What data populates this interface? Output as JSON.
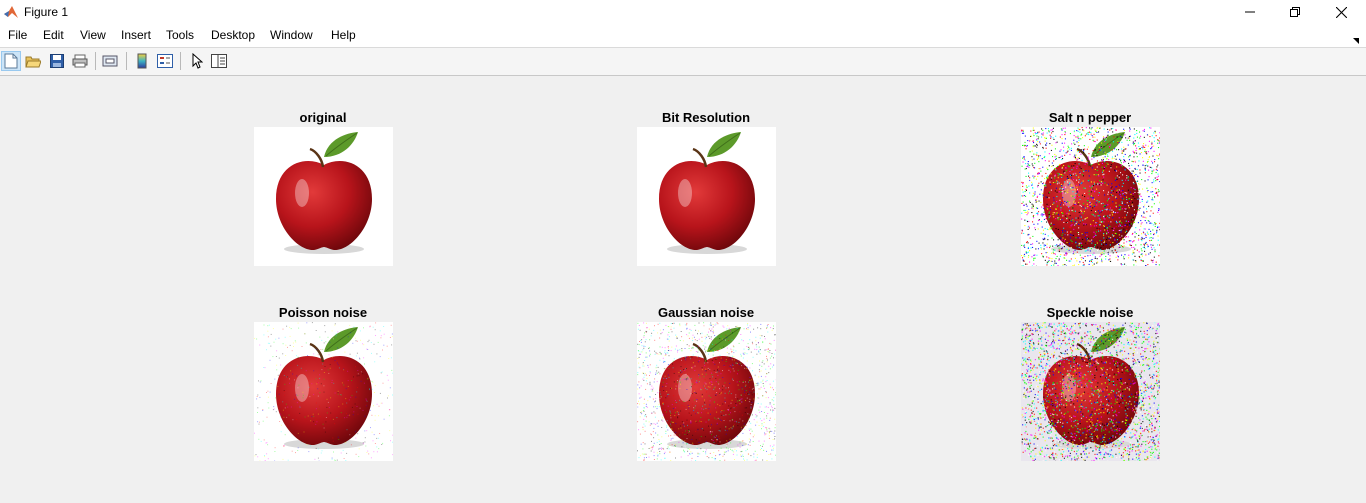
{
  "window": {
    "title": "Figure 1"
  },
  "menu": {
    "items": [
      "File",
      "Edit",
      "View",
      "Insert",
      "Tools",
      "Desktop",
      "Window",
      "Help"
    ]
  },
  "toolbar": {
    "buttons": [
      {
        "icon": "new-figure-icon"
      },
      {
        "icon": "open-file-icon"
      },
      {
        "icon": "save-icon"
      },
      {
        "icon": "print-icon"
      },
      {
        "icon": "link-icon"
      },
      {
        "icon": "colorbar-icon"
      },
      {
        "icon": "legend-icon"
      },
      {
        "icon": "pointer-icon"
      },
      {
        "icon": "property-editor-icon"
      }
    ]
  },
  "subplots": [
    {
      "title": "original",
      "noise": "none"
    },
    {
      "title": "Bit Resolution",
      "noise": "none"
    },
    {
      "title": "Salt n pepper",
      "noise": "salt-pepper"
    },
    {
      "title": "Poisson noise",
      "noise": "light"
    },
    {
      "title": "Gaussian noise",
      "noise": "gaussian"
    },
    {
      "title": "Speckle noise",
      "noise": "speckle"
    }
  ],
  "colors": {
    "apple_red": "#b8141b",
    "leaf_green": "#5c9a2a",
    "figure_bg": "#f0f0f0"
  }
}
